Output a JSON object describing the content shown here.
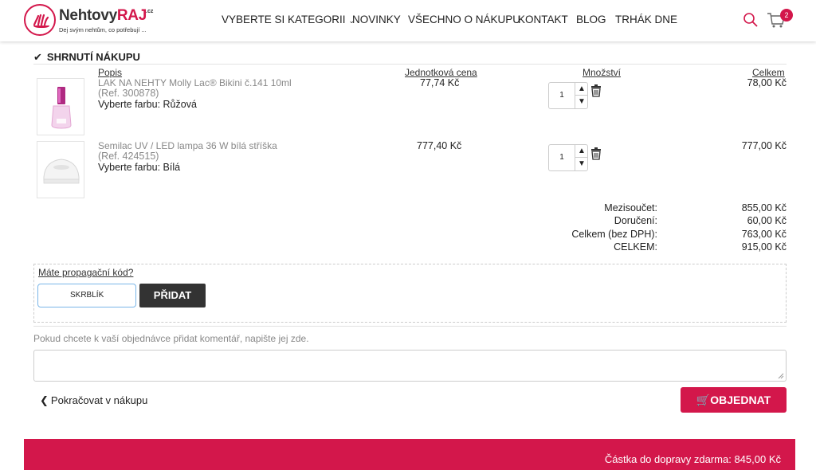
{
  "logo": {
    "name_part1": "Nehtovy",
    "name_part2": "RAJ",
    "domain": ".cz",
    "tagline": "Dej svým nehtům, co potřebují ..."
  },
  "nav": {
    "items": [
      {
        "label": "VYBERTE SI KATEGORII"
      },
      {
        "label": "NOVINKY"
      },
      {
        "label": "VŠECHNO O NÁKUPU"
      },
      {
        "label": "KONTAKT"
      },
      {
        "label": "BLOG"
      },
      {
        "label": "TRHÁK DNE"
      }
    ],
    "cart_count": "2"
  },
  "summary": {
    "title": "SHRNUTÍ NÁKUPU",
    "columns": {
      "description": "Popis",
      "unit_price": "Jednotková cena",
      "quantity": "Množství",
      "total": "Celkem"
    },
    "items": [
      {
        "name": "LAK NA NEHTY Molly Lac® Bikini č.141 10ml",
        "ref": "(Ref. 300878)",
        "variant": "Vyberte farbu: Růžová",
        "unit_price": "77,74 Kč",
        "quantity": "1",
        "total": "78,00 Kč"
      },
      {
        "name": "Semilac UV / LED lampa 36 W bílá stříška",
        "ref": "(Ref. 424515)",
        "variant": "Vyberte farbu: Bílá",
        "unit_price": "777,40 Kč",
        "quantity": "1",
        "total": "777,00 Kč"
      }
    ],
    "totals": {
      "subtotal_label": "Mezisoučet:",
      "subtotal": "855,00 Kč",
      "delivery_label": "Doručení:",
      "delivery": "60,00 Kč",
      "net_label": "Celkem (bez DPH):",
      "net": "763,00 Kč",
      "grand_label": "CELKEM:",
      "grand": "915,00 Kč"
    }
  },
  "promo": {
    "link": "Máte propagační kód?",
    "code_value": "SKRBLÍK",
    "add_button": "PŘIDAT"
  },
  "comment": {
    "label": "Pokud chcete k vaší objednávce přidat komentář, napište jej zde.",
    "value": ""
  },
  "actions": {
    "continue": "Pokračovat v nákupu",
    "order": "OBJEDNAT"
  },
  "footer": {
    "free_shipping": "Částka do dopravy zdarma: 845,00 Kč"
  },
  "colors": {
    "brand": "#d3174b",
    "button_dark": "#333333"
  }
}
